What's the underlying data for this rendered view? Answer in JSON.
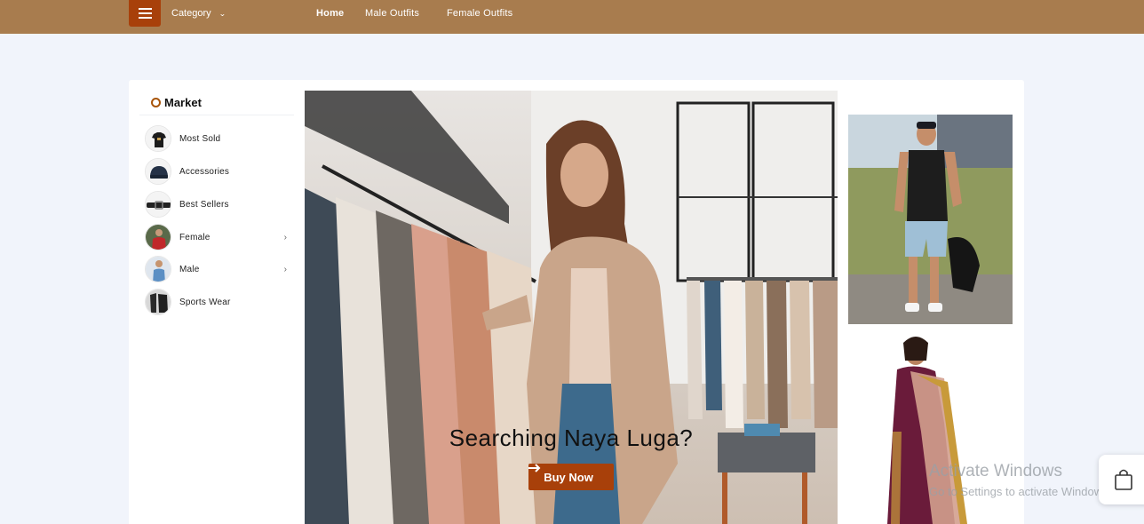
{
  "header": {
    "category_label": "Category",
    "nav": [
      "Home",
      "Male Outfits",
      "Female Outfits"
    ]
  },
  "sidebar": {
    "title": "Market",
    "items": [
      {
        "label": "Most Sold",
        "has_submenu": false
      },
      {
        "label": "Accessories",
        "has_submenu": false
      },
      {
        "label": "Best Sellers",
        "has_submenu": false
      },
      {
        "label": "Female",
        "has_submenu": true
      },
      {
        "label": "Male",
        "has_submenu": true
      },
      {
        "label": "Sports Wear",
        "has_submenu": false
      }
    ]
  },
  "banner": {
    "title": "Searching Naya Luga?",
    "button_label": "Buy Now"
  },
  "watermark": {
    "line1": "Activate Windows",
    "line2": "Go to Settings to activate Windows."
  },
  "colors": {
    "topbar": "#a87c4e",
    "accent": "#a8400a",
    "background": "#f1f4fb"
  },
  "icons": [
    "menu-icon",
    "chevron-down-icon",
    "chevron-right-icon",
    "arrow-right-icon",
    "shopping-bag-icon"
  ]
}
